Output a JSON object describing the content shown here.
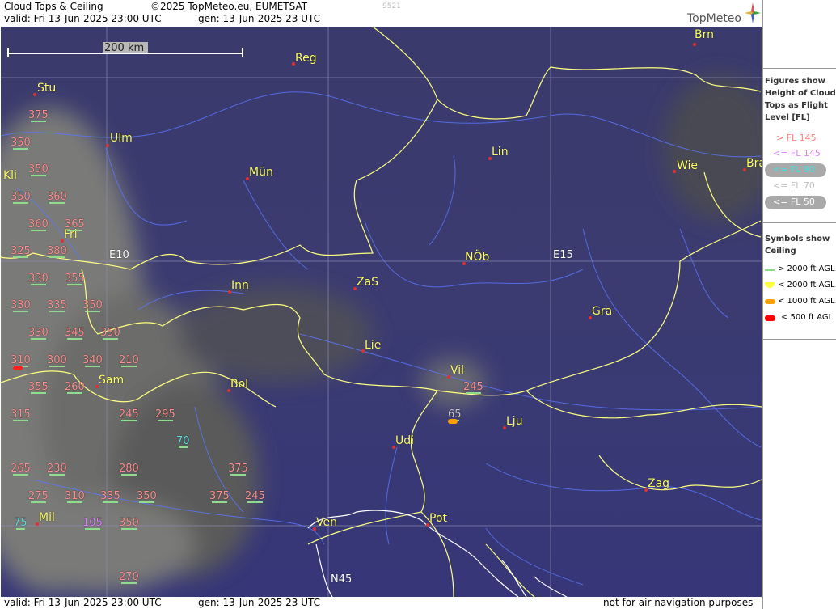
{
  "header": {
    "title": "Cloud Tops & Ceiling",
    "copyright": "©2025 TopMeteo.eu, EUMETSAT",
    "code": "9521",
    "valid": "valid:  Fri  13-Jun-2025  23:00 UTC",
    "gen": "gen: 13-Jun-2025 23 UTC",
    "brand": "TopMeteo"
  },
  "footer": {
    "valid": "valid:  Fri  13-Jun-2025  23:00 UTC",
    "gen": "gen: 13-Jun-2025 23 UTC",
    "disclaimer": "not for air navigation purposes"
  },
  "map": {
    "scale_label": "200 km",
    "grid_labels": {
      "e10": "E10",
      "e15": "E15",
      "n45": "N45"
    },
    "cities": {
      "brn": "Brn",
      "reg": "Reg",
      "stu": "Stu",
      "ulm": "Ulm",
      "mun": "Mün",
      "lin": "Lin",
      "wie": "Wie",
      "bra": "Bra",
      "kli": "Kli",
      "fri": "Fri",
      "nob": "NÖb",
      "inn": "Inn",
      "zas": "ZaS",
      "gra": "Gra",
      "lie": "Lie",
      "vil": "Vil",
      "sam": "Sam",
      "bol": "Bol",
      "lju": "Lju",
      "udi": "Udi",
      "zag": "Zag",
      "mil": "Mil",
      "ven": "Ven",
      "pot": "Pot"
    },
    "flight_levels": {
      "l375a": "375",
      "l350a": "350",
      "l350b": "350",
      "l350c": "350",
      "l360a": "360",
      "l360b": "360",
      "l365": "365",
      "l325": "325",
      "l380": "380",
      "l330a": "330",
      "l355a": "355",
      "l330b": "330",
      "l335a": "335",
      "l350d": "350",
      "l330c": "330",
      "l345": "345",
      "l350e": "350",
      "l310a": "310",
      "l300": "300",
      "l340": "340",
      "l210": "210",
      "l355b": "355",
      "l260": "260",
      "l245a": "245",
      "l315": "315",
      "l245b": "245",
      "l295": "295",
      "l65": "65",
      "l70": "70",
      "l265": "265",
      "l230": "230",
      "l280": "280",
      "l375b": "375",
      "l275": "275",
      "l310b": "310",
      "l335b": "335",
      "l350f": "350",
      "l375c": "375",
      "l245c": "245",
      "l75": "75",
      "l105": "105",
      "l350g": "350",
      "l270": "270"
    }
  },
  "legend": {
    "heading": "Figures show Height of Cloud Tops as Flight Level  [FL]",
    "levels": [
      {
        "label": "> FL 145",
        "color": "#ff8080"
      },
      {
        "label": "<= FL 145",
        "color": "#e080ff"
      },
      {
        "label": "<= FL 90",
        "color": "#40e0e0"
      },
      {
        "label": "<= FL 70",
        "color": "#c0c0c0"
      },
      {
        "label": "<= FL 50",
        "color": "#ffffff"
      }
    ],
    "symbols_heading": "Symbols show Ceiling",
    "symbols": [
      {
        "label": "> 2000 ft AGL",
        "color": "#8fdc8f"
      },
      {
        "label": "< 2000 ft AGL",
        "color": "#ffff40"
      },
      {
        "label": "< 1000 ft AGL",
        "color": "#ffa000"
      },
      {
        "label": "< 500 ft AGL",
        "color": "#ff0000"
      }
    ]
  }
}
